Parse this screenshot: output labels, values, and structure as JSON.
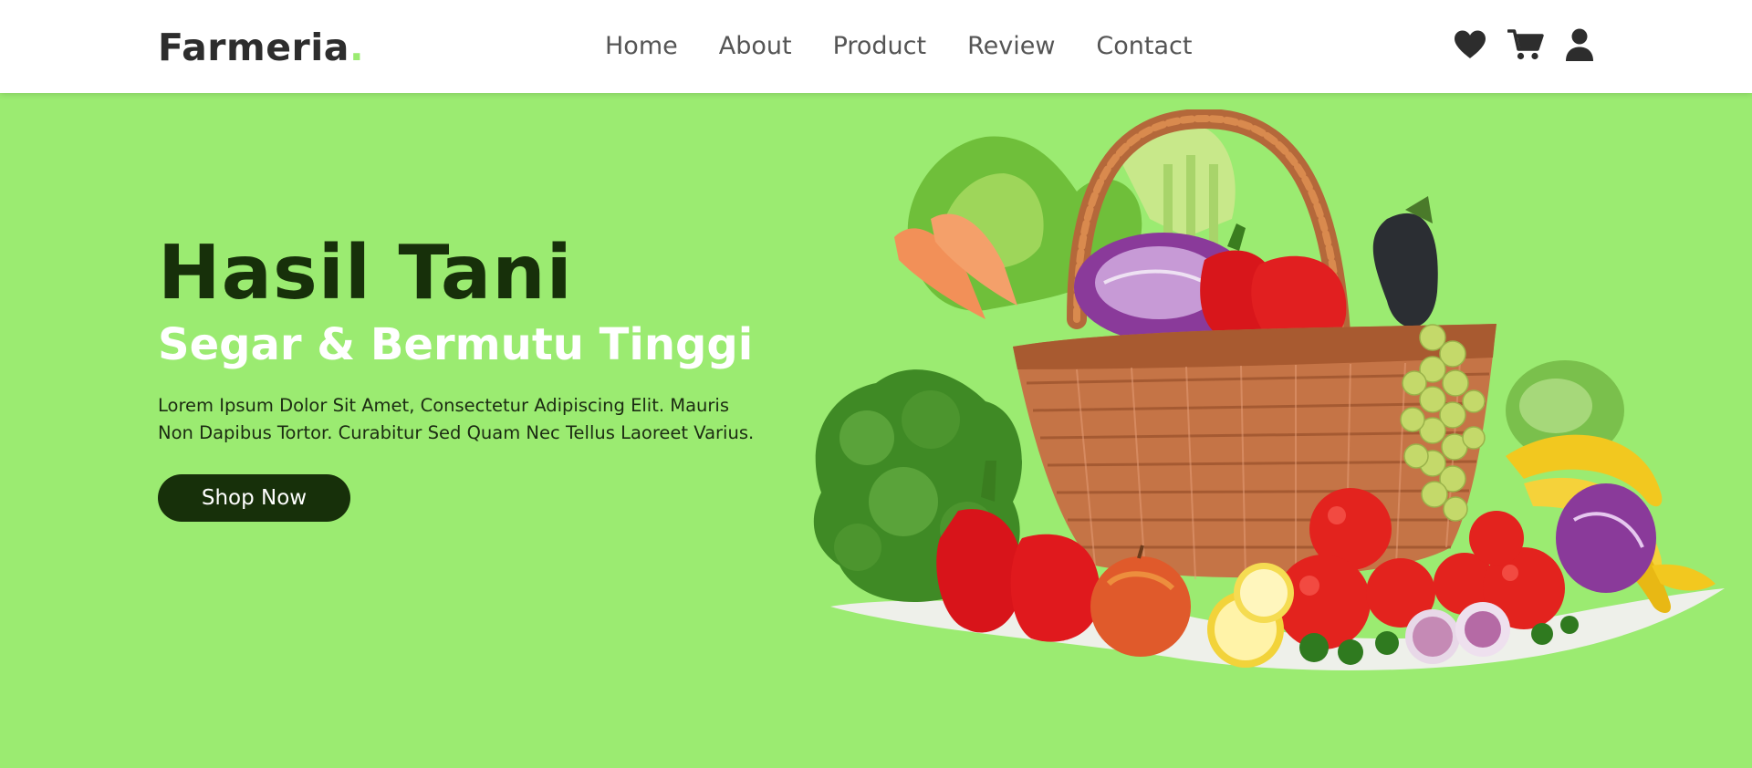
{
  "brand": {
    "name": "Farmeria",
    "dot": "."
  },
  "nav": {
    "links": [
      {
        "label": "Home"
      },
      {
        "label": "About"
      },
      {
        "label": "Product"
      },
      {
        "label": "Review"
      },
      {
        "label": "Contact"
      }
    ],
    "icons": [
      "heart-icon",
      "cart-icon",
      "user-icon"
    ]
  },
  "hero": {
    "title": "Hasil Tani",
    "subtitle": "Segar & Bermutu Tinggi",
    "description": "Lorem Ipsum Dolor Sit Amet, Consectetur Adipiscing Elit. Mauris Non Dapibus Tortor. Curabitur Sed Quam Nec Tellus Laoreet Varius.",
    "cta_label": "Shop Now",
    "image": "vegetable-basket"
  },
  "colors": {
    "background": "#9beb71",
    "brand_dark": "#17300a",
    "nav_text": "#555555",
    "logo_text": "#2d2d2d"
  }
}
